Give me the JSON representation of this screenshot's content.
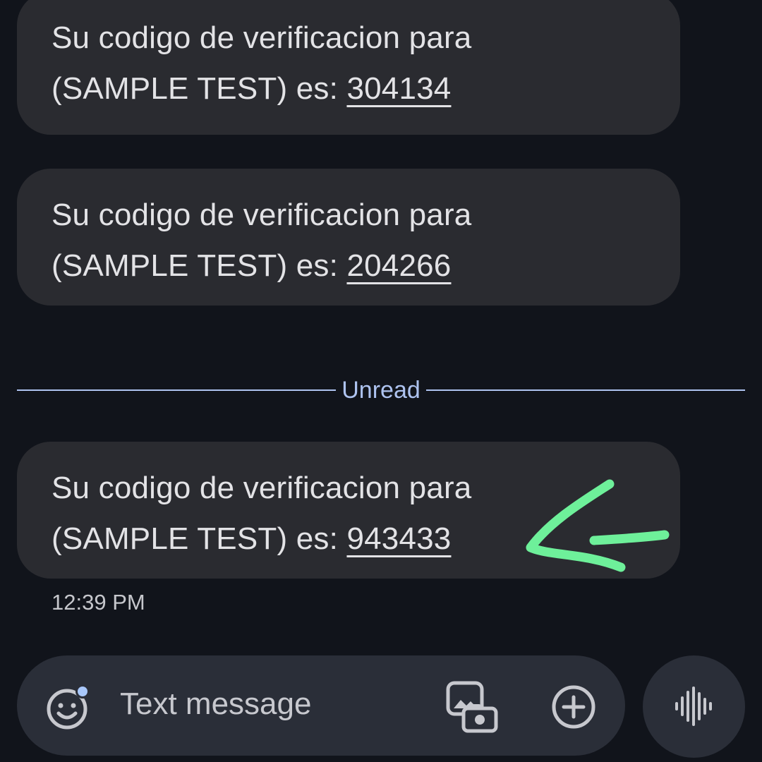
{
  "messages": [
    {
      "line1": "Su codigo de verificacion para",
      "line2_prefix": "(SAMPLE TEST) es: ",
      "code": "304134"
    },
    {
      "line1": "Su codigo de verificacion para",
      "line2_prefix": "(SAMPLE TEST) es: ",
      "code": "204266"
    },
    {
      "line1": "Su codigo de verificacion para",
      "line2_prefix": "(SAMPLE TEST) es: ",
      "code": "943433"
    }
  ],
  "divider": {
    "label": "Unread"
  },
  "timestamp": "12:39 PM",
  "composer": {
    "placeholder": "Text message",
    "emoji_icon": "emoji-icon",
    "gallery_icon": "gallery-camera-icon",
    "add_icon": "add-circle-icon",
    "voice_icon": "voice-waveform-icon"
  },
  "colors": {
    "background": "#11141b",
    "bubble": "#2a2b30",
    "composer": "#2a2e38",
    "divider": "#aec3f0",
    "annotation": "#6ef09a",
    "badge_dot": "#a8c7fa"
  }
}
